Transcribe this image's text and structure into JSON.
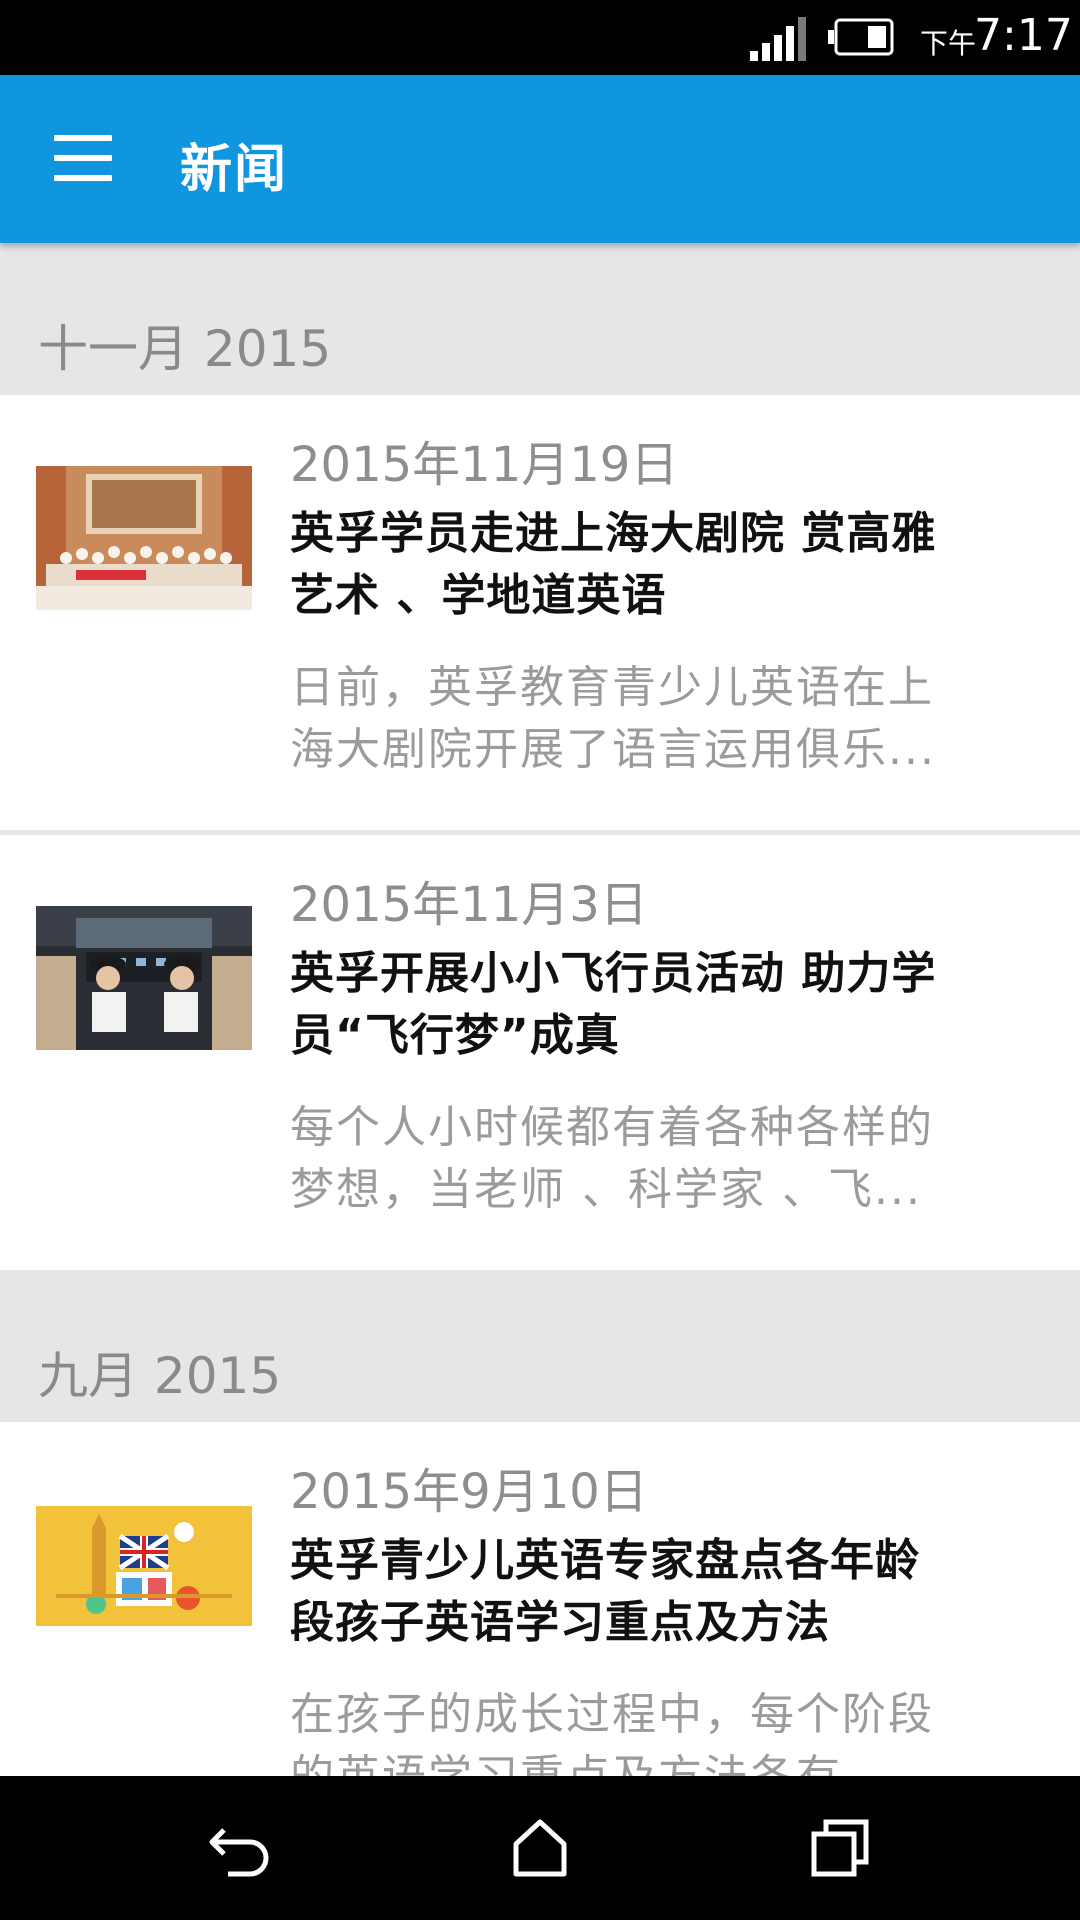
{
  "status_bar": {
    "ampm": "下午",
    "time": "7:17",
    "icons": [
      "signal-icon",
      "battery-icon"
    ]
  },
  "app_bar": {
    "menu_icon": "menu-icon",
    "title": "新闻",
    "color": "#0f96de"
  },
  "sections": [
    {
      "title": "十一月 2015",
      "items": [
        {
          "date": "2015年11月19日",
          "title_lines": [
            "英孚学员走进上海大剧院 赏高雅",
            "艺术 、学地道英语"
          ],
          "excerpt_lines": [
            "日前，英孚教育青少儿英语在上",
            "海大剧院开展了语言运用俱乐..."
          ],
          "thumbnail": "group-photo-theater"
        },
        {
          "date": "2015年11月3日",
          "title_lines": [
            "英孚开展小小飞行员活动 助力学",
            "员“飞行梦”成真"
          ],
          "excerpt_lines": [
            "每个人小时候都有着各种各样的",
            "梦想，当老师 、科学家 、飞..."
          ],
          "thumbnail": "kids-cockpit-photo"
        }
      ]
    },
    {
      "title": "九月 2015",
      "items": [
        {
          "date": "2015年9月10日",
          "title_lines": [
            "英孚青少儿英语专家盘点各年龄",
            "段孩子英语学习重点及方法"
          ],
          "excerpt_lines": [
            "在孩子的成长过程中，每个阶段",
            "的英语学习重点及方法各有..."
          ],
          "thumbnail": "london-book-illustration"
        }
      ]
    }
  ],
  "nav_bar": {
    "icons": [
      "back-icon",
      "home-icon",
      "recents-icon"
    ]
  }
}
